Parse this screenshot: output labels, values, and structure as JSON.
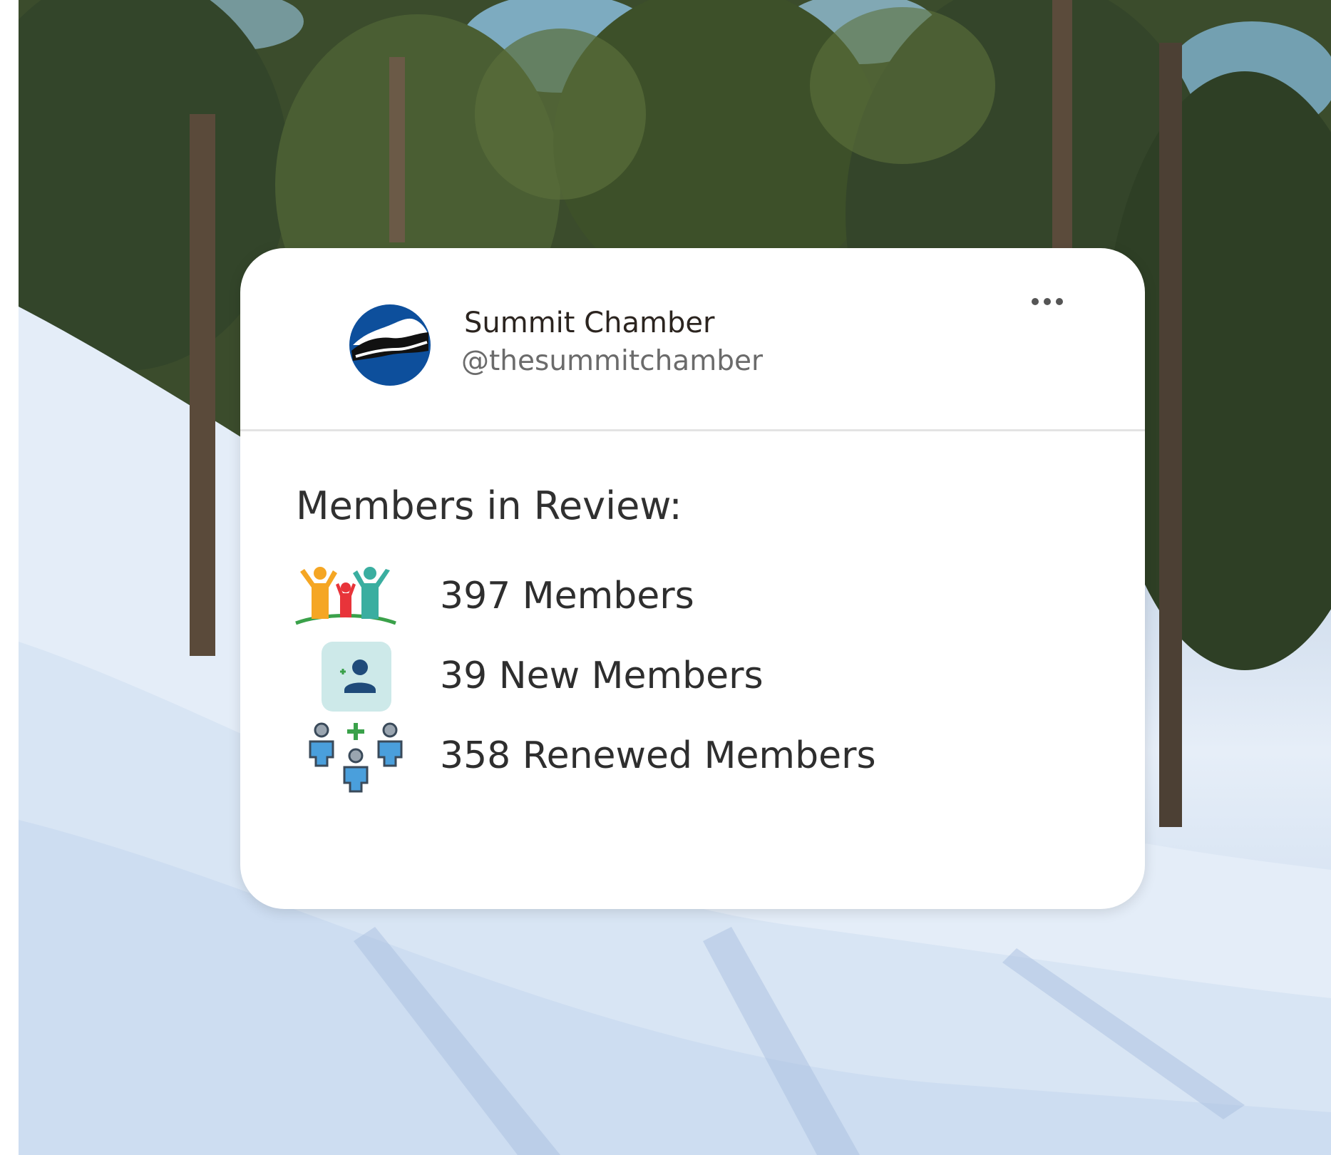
{
  "profile": {
    "name": "Summit Chamber",
    "handle": "@thesummitchamber"
  },
  "menu": {
    "icon": "more-horizontal-icon"
  },
  "review": {
    "title": "Members in Review:",
    "stats": [
      {
        "label": "397 Members",
        "icon": "member-group-icon"
      },
      {
        "label": "39 New Members",
        "icon": "add-user-icon"
      },
      {
        "label": "358 Renewed Members",
        "icon": "renewed-members-icon"
      }
    ]
  },
  "colors": {
    "logo_blue": "#0d4f9c",
    "card_background": "#ffffff",
    "text_primary": "#2e2e2e",
    "text_secondary": "#6b6b6b"
  }
}
